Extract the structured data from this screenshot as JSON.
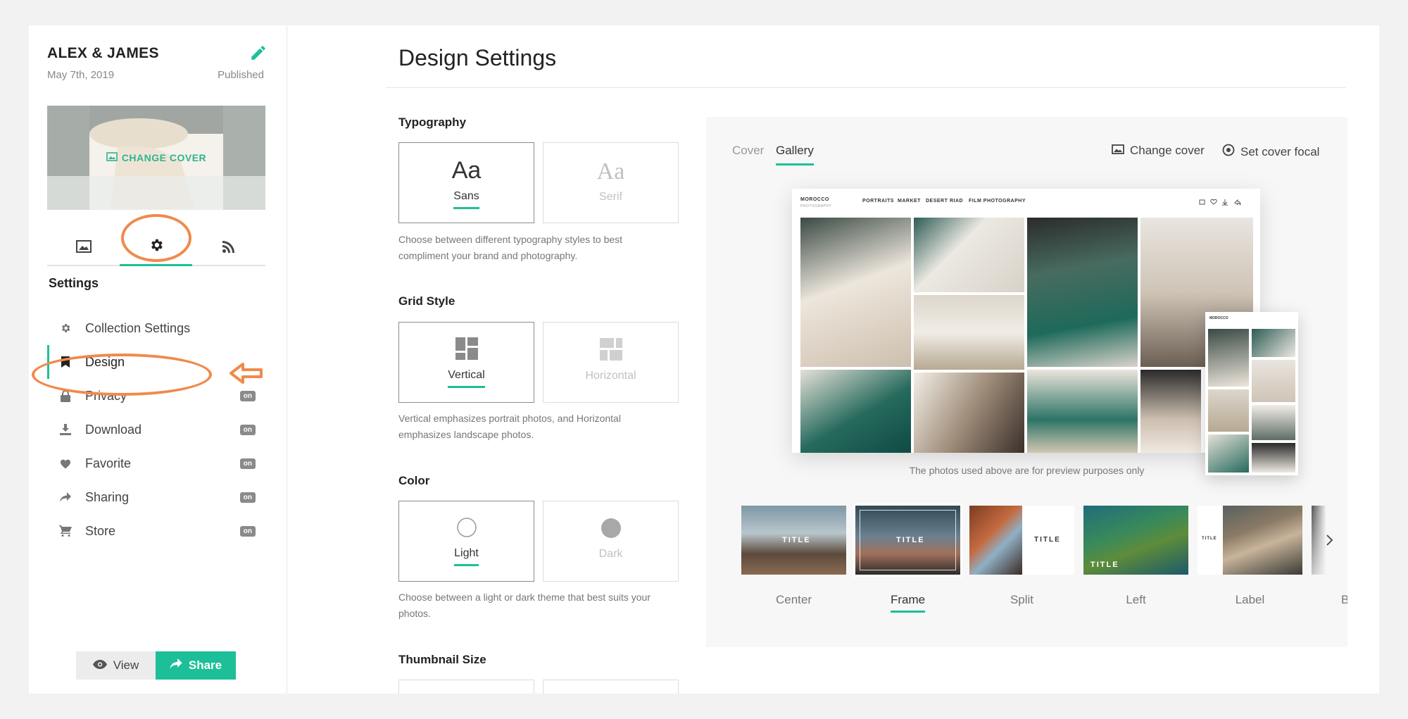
{
  "sidebar": {
    "title": "ALEX & JAMES",
    "date": "May 7th, 2019",
    "status": "Published",
    "change_cover": "CHANGE COVER",
    "section_heading": "Settings",
    "items": [
      {
        "label": "Collection Settings",
        "icon": "gear-icon",
        "badge": ""
      },
      {
        "label": "Design",
        "icon": "bookmark-icon",
        "badge": ""
      },
      {
        "label": "Privacy",
        "icon": "lock-icon",
        "badge": "on"
      },
      {
        "label": "Download",
        "icon": "download-icon",
        "badge": "on"
      },
      {
        "label": "Favorite",
        "icon": "heart-icon",
        "badge": "on"
      },
      {
        "label": "Sharing",
        "icon": "share-icon",
        "badge": "on"
      },
      {
        "label": "Store",
        "icon": "cart-icon",
        "badge": "on"
      }
    ],
    "view_label": "View",
    "share_label": "Share"
  },
  "main": {
    "title": "Design Settings",
    "typography": {
      "heading": "Typography",
      "glyph": "Aa",
      "options": [
        "Sans",
        "Serif"
      ],
      "selected": "Sans",
      "description": "Choose between different typography styles to best compliment your brand and photography."
    },
    "grid": {
      "heading": "Grid Style",
      "options": [
        "Vertical",
        "Horizontal"
      ],
      "selected": "Vertical",
      "description": "Vertical emphasizes portrait photos, and Horizontal emphasizes landscape photos."
    },
    "color": {
      "heading": "Color",
      "options": [
        "Light",
        "Dark"
      ],
      "selected": "Light",
      "description": "Choose between a light or dark theme that best suits your photos."
    },
    "thumbnail": {
      "heading": "Thumbnail Size"
    }
  },
  "preview": {
    "tabs": [
      "Cover",
      "Gallery"
    ],
    "active_tab": "Gallery",
    "change_cover": "Change cover",
    "set_focal": "Set cover focal",
    "mock_brand": "MOROCCO",
    "mock_sub": "PHOTOGRAPHY",
    "mock_nav": [
      "PORTRAITS",
      "MARKET",
      "DESERT",
      "RIAD",
      "FILM PHOTOGRAPHY"
    ],
    "phone_brand": "MOROCCO",
    "note": "The photos used above are for preview purposes only",
    "cover_styles": [
      {
        "name": "Center",
        "title": "TITLE"
      },
      {
        "name": "Frame",
        "title": "TITLE"
      },
      {
        "name": "Split",
        "title": "TITLE"
      },
      {
        "name": "Left",
        "title": "TITLE"
      },
      {
        "name": "Label",
        "title": "TITLE"
      },
      {
        "name": "B",
        "title": ""
      }
    ],
    "selected_style": "Frame"
  },
  "colors": {
    "accent": "#1dbf98",
    "annotation": "#f08a4b"
  }
}
